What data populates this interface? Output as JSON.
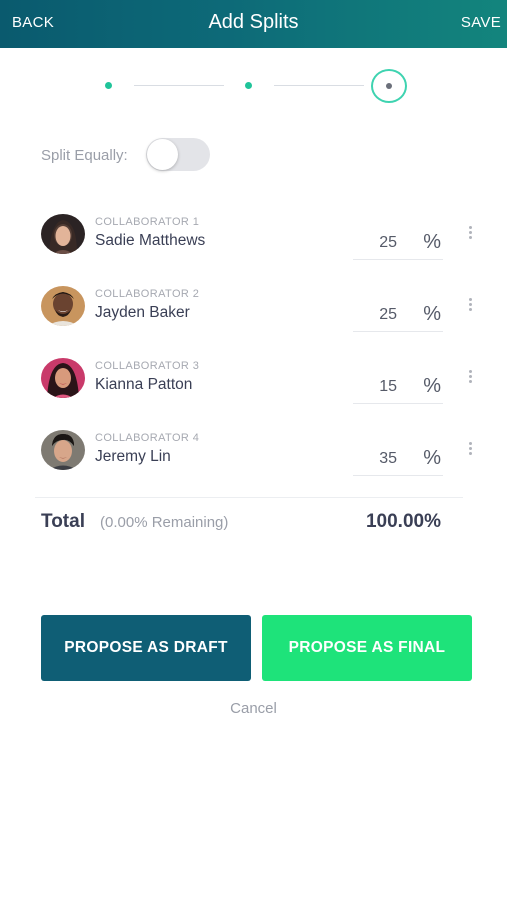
{
  "header": {
    "back_label": "BACK",
    "title": "Add Splits",
    "save_label": "SAVE",
    "gradient_start": "#0a5a6e",
    "gradient_end": "#13857d"
  },
  "stepper": {
    "total_steps": 3,
    "current_step": 3
  },
  "split_equally": {
    "label": "Split Equally:",
    "enabled": false
  },
  "collaborators": [
    {
      "role": "COLLABORATOR 1",
      "name": "Sadie Matthews",
      "percent": "25",
      "percent_sign": "%"
    },
    {
      "role": "COLLABORATOR 2",
      "name": "Jayden Baker",
      "percent": "25",
      "percent_sign": "%"
    },
    {
      "role": "COLLABORATOR 3",
      "name": "Kianna Patton",
      "percent": "15",
      "percent_sign": "%"
    },
    {
      "role": "COLLABORATOR 4",
      "name": "Jeremy Lin",
      "percent": "35",
      "percent_sign": "%"
    }
  ],
  "total": {
    "label": "Total",
    "remaining": "(0.00%  Remaining)",
    "value": "100.00%"
  },
  "actions": {
    "draft_label": "PROPOSE AS DRAFT",
    "final_label": "PROPOSE AS FINAL",
    "cancel_label": "Cancel",
    "draft_color": "#0f5e75",
    "final_color": "#1ee37a"
  }
}
